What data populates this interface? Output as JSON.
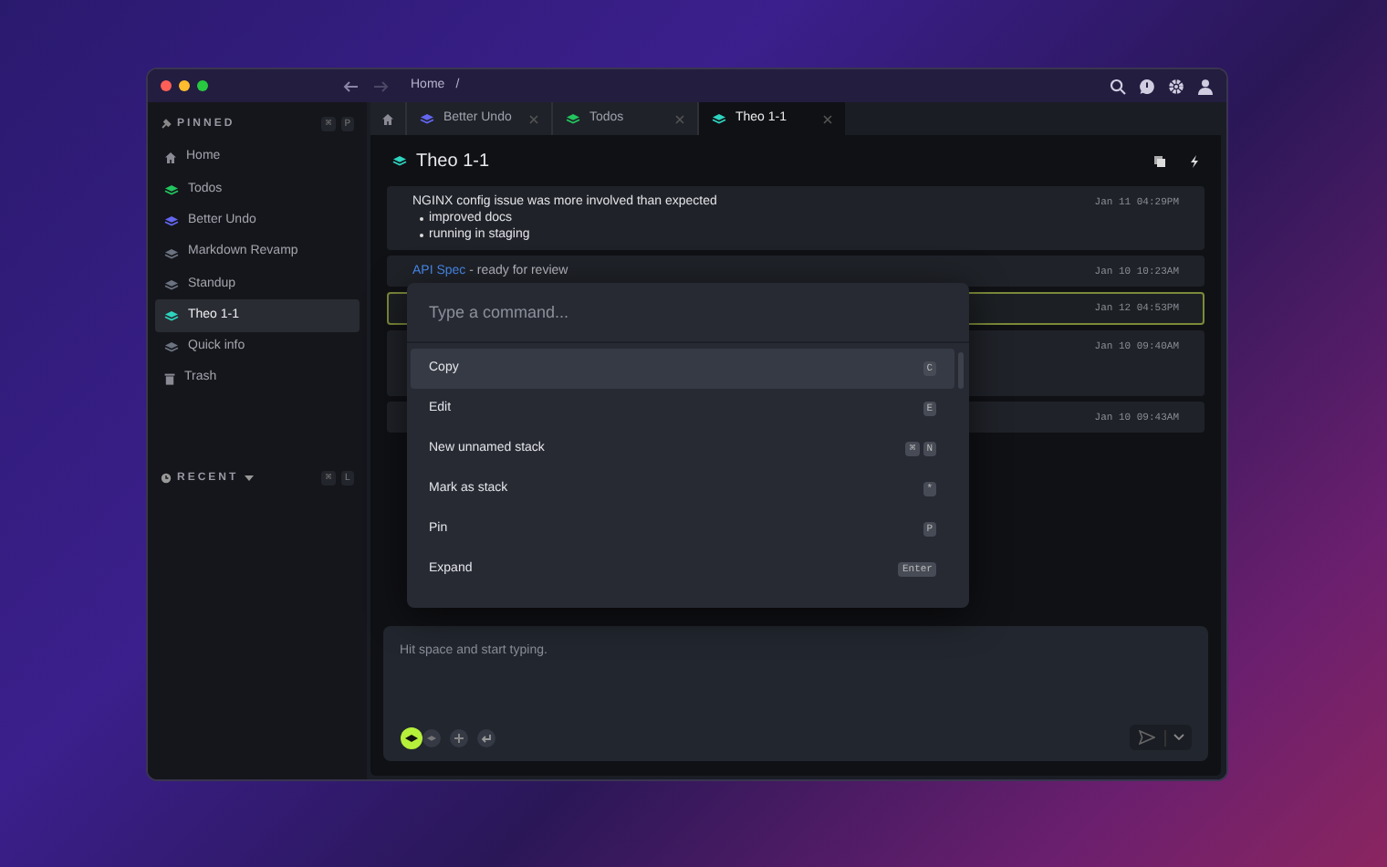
{
  "window": {
    "breadcrumb": "Home",
    "breadcrumb_separator": "/"
  },
  "sidebar": {
    "pinned_label": "PINNED",
    "pinned_keys": [
      "⌘",
      "P"
    ],
    "items": [
      {
        "label": "Home",
        "kind": "home",
        "selected": false
      },
      {
        "label": "Todos",
        "kind": "stack",
        "color": "#22c55e",
        "selected": false
      },
      {
        "label": "Better Undo",
        "kind": "stack",
        "color": "#6366f1",
        "selected": false
      },
      {
        "label": "Markdown Revamp",
        "kind": "stack",
        "color": "#6b7280",
        "selected": false
      },
      {
        "label": "Standup",
        "kind": "stack",
        "color": "#6b7280",
        "selected": false
      },
      {
        "label": "Theo 1-1",
        "kind": "stack",
        "color": "#2dd4bf",
        "selected": true
      },
      {
        "label": "Quick info",
        "kind": "stack",
        "color": "#6b7280",
        "selected": false
      },
      {
        "label": "Trash",
        "kind": "trash",
        "selected": false
      }
    ],
    "recent_label": "RECENT",
    "recent_keys": [
      "⌘",
      "L"
    ]
  },
  "tabs": [
    {
      "kind": "home",
      "selected": false
    },
    {
      "kind": "stack",
      "label": "Better Undo",
      "color": "#6366f1",
      "selected": false
    },
    {
      "kind": "stack",
      "label": "Todos",
      "color": "#22c55e",
      "selected": false
    },
    {
      "kind": "stack",
      "label": "Theo 1-1",
      "color": "#2dd4bf",
      "selected": true
    }
  ],
  "page": {
    "title": "Theo 1-1",
    "color": "#2dd4bf"
  },
  "feed": [
    {
      "text": "NGINX config issue was more involved than expected",
      "bullets": [
        "improved docs",
        "running in staging"
      ],
      "time": "Jan 11 04:29PM",
      "selected": false
    },
    {
      "link": "API Spec",
      "text": " - ready for review",
      "time": "Jan 10 10:23AM",
      "selected": false
    },
    {
      "time": "Jan 12 04:53PM",
      "selected": true
    },
    {
      "time": "Jan 10 09:40AM",
      "selected": false,
      "tall": true
    },
    {
      "time": "Jan 10 09:43AM",
      "selected": false
    }
  ],
  "command_palette": {
    "placeholder": "Type a command...",
    "commands": [
      {
        "label": "Copy",
        "keys": [
          "C"
        ],
        "selected": true
      },
      {
        "label": "Edit",
        "keys": [
          "E"
        ],
        "selected": false
      },
      {
        "label": "New unnamed stack",
        "keys": [
          "⌘",
          "N"
        ],
        "selected": false
      },
      {
        "label": "Mark as stack",
        "keys": [
          "*"
        ],
        "selected": false
      },
      {
        "label": "Pin",
        "keys": [
          "P"
        ],
        "selected": false
      },
      {
        "label": "Expand",
        "keys": [
          "Enter"
        ],
        "selected": false
      }
    ]
  },
  "composer": {
    "placeholder": "Hit space and start typing."
  }
}
